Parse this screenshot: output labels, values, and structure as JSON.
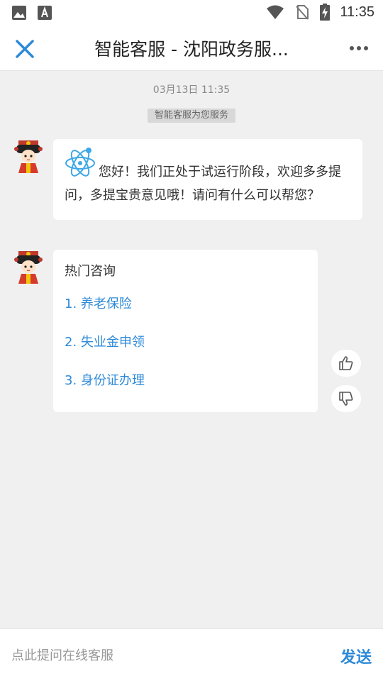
{
  "status_bar": {
    "time": "11:35",
    "icons": [
      "image-icon",
      "font-icon",
      "wifi-icon",
      "no-sim-icon",
      "battery-charging-icon"
    ]
  },
  "header": {
    "title": "智能客服 - 沈阳政务服...",
    "close_icon": "close-icon",
    "more_icon": "more-icon"
  },
  "chat": {
    "timestamp": "03月13日 11:35",
    "notice": "智能客服为您服务",
    "greeting": "您好！我们正处于试运行阶段，欢迎多多提问，多提宝贵意见哦！请问有什么可以帮您？",
    "hot": {
      "title": "热门咨询",
      "items": [
        "1. 养老保险",
        "2. 失业金申领",
        "3. 身份证办理"
      ]
    }
  },
  "input": {
    "placeholder": "点此提问在线客服",
    "send_label": "发送"
  },
  "colors": {
    "accent": "#2e8ad8",
    "background": "#f0f0f0",
    "bubble": "#ffffff"
  }
}
